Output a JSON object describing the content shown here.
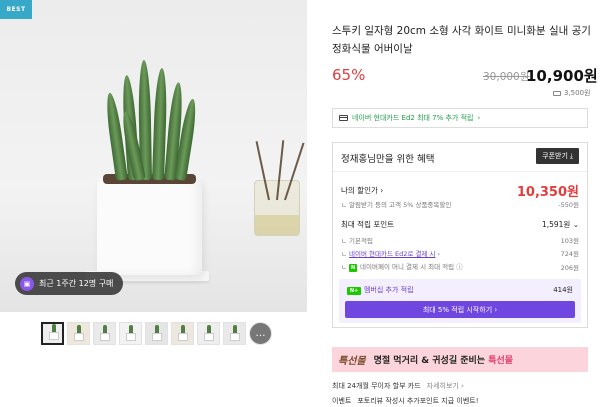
{
  "gallery": {
    "badge": "BEST",
    "buy_pill": "최근 1주간 12명 구매",
    "more_icon": "…"
  },
  "product": {
    "title": "스투키 일자형 20cm 소형 사각 화이트 미니화분 실내 공기정화식물 어버이날",
    "discount": "65%",
    "original_price": "30,000원",
    "sale_price": "10,900원",
    "shipping": "3,500원"
  },
  "card_banner": {
    "text": "네이버 현대카드 Ed2 최대 7% 추가 적립",
    "chevron": "›"
  },
  "benefits": {
    "heading": "정재홍님만을 위한 혜택",
    "coupon_button": "쿠폰받기",
    "my_price_label": "나의 할인가",
    "my_price_value": "10,350원",
    "alarm_label": "알림받기 등의 고객 5% 상품중복할인",
    "alarm_value": "-550원",
    "max_points_label": "최대 적립 포인트",
    "max_points_value": "1,591원",
    "basic_label": "기본적립",
    "basic_value": "103원",
    "card_label": "네이버 현대카드 Ed2로 결제 시",
    "card_value": "724원",
    "npay_label": "네이버페이 머니 결제 시 최대 적립",
    "npay_value": "206원",
    "membership_label": "멤버십 추가 적립",
    "membership_value": "414원",
    "membership_button": "최대 5% 적립 시작하기"
  },
  "promo": {
    "logo": "특선몰",
    "text_a": "명절 먹거리 & 귀성길 준비는 ",
    "text_b": "특선몰"
  },
  "footer": {
    "installment": "최대 24개월 무이자 할부 카드",
    "installment_more": "자세히보기",
    "event_label": "이벤트",
    "event_text": "포토리뷰 작성시 추가포인트 지급 이벤트!"
  },
  "colors": {
    "discount_red": "#e23d3d",
    "naver_green": "#20a04a",
    "membership_purple": "#7046e0",
    "promo_pink": "#fcd4dc"
  }
}
